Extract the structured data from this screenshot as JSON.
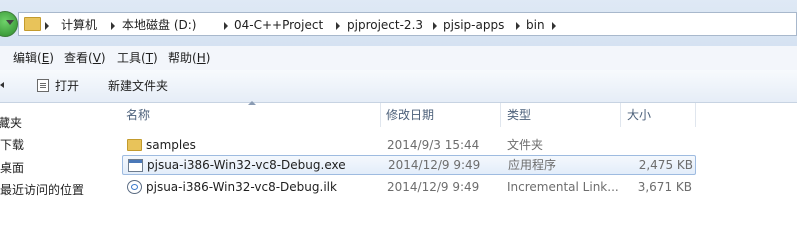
{
  "address_bar": {
    "breadcrumbs": [
      "计算机",
      "本地磁盘 (D:)",
      "04-C++Project",
      "pjproject-2.3",
      "pjsip-apps",
      "bin"
    ]
  },
  "menu": {
    "items": [
      {
        "label": "编辑(",
        "key": "E",
        "suffix": ")"
      },
      {
        "label": "查看(",
        "key": "V",
        "suffix": ")"
      },
      {
        "label": "工具(",
        "key": "T",
        "suffix": ")"
      },
      {
        "label": "帮助(",
        "key": "H",
        "suffix": ")"
      }
    ]
  },
  "toolbar": {
    "open_label": "打开",
    "new_folder_label": "新建文件夹"
  },
  "nav_pane": {
    "items": [
      "藏夹",
      "下载",
      "桌面",
      "最近访问的位置"
    ]
  },
  "columns": {
    "name": "名称",
    "date": "修改日期",
    "type": "类型",
    "size": "大小"
  },
  "files": [
    {
      "name": "samples",
      "date": "2014/9/3 15:44",
      "type": "文件夹",
      "size": "",
      "icon": "folder-icon"
    },
    {
      "name": "pjsua-i386-Win32-vc8-Debug.exe",
      "date": "2014/12/9 9:49",
      "type": "应用程序",
      "size": "2,475 KB",
      "icon": "exe-icon",
      "selected": true
    },
    {
      "name": "pjsua-i386-Win32-vc8-Debug.ilk",
      "date": "2014/12/9 9:49",
      "type": "Incremental Link...",
      "size": "3,671 KB",
      "icon": "ilk-icon"
    }
  ]
}
